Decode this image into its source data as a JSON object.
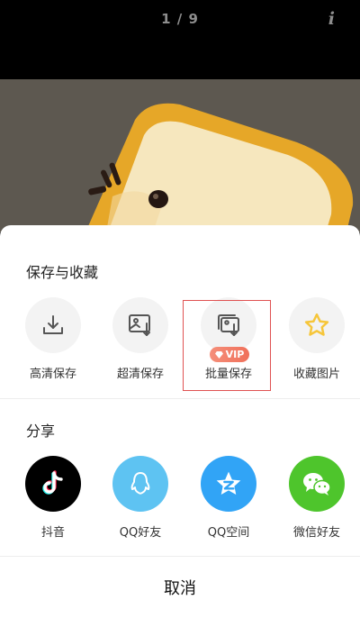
{
  "header": {
    "page_counter": "1 / 9",
    "info_icon": "info-icon"
  },
  "sheet": {
    "save_section_title": "保存与收藏",
    "save_items": [
      {
        "label": "高清保存",
        "icon": "download-icon"
      },
      {
        "label": "超清保存",
        "icon": "image-download-icon"
      },
      {
        "label": "批量保存",
        "icon": "batch-save-icon"
      },
      {
        "label": "收藏图片",
        "icon": "star-icon"
      }
    ],
    "vip_badge": "VIP",
    "share_section_title": "分享",
    "share_items": [
      {
        "label": "抖音",
        "icon": "douyin-icon",
        "color": "#000000"
      },
      {
        "label": "QQ好友",
        "icon": "qq-icon",
        "color": "#5ec3f2"
      },
      {
        "label": "QQ空间",
        "icon": "qzone-icon",
        "color": "#31a4f6"
      },
      {
        "label": "微信好友",
        "icon": "wechat-icon",
        "color": "#4ec52c"
      }
    ],
    "cancel_label": "取消"
  },
  "colors": {
    "highlight_border": "#e05252",
    "vip_badge": "#f0705a",
    "star": "#f6c63a"
  }
}
